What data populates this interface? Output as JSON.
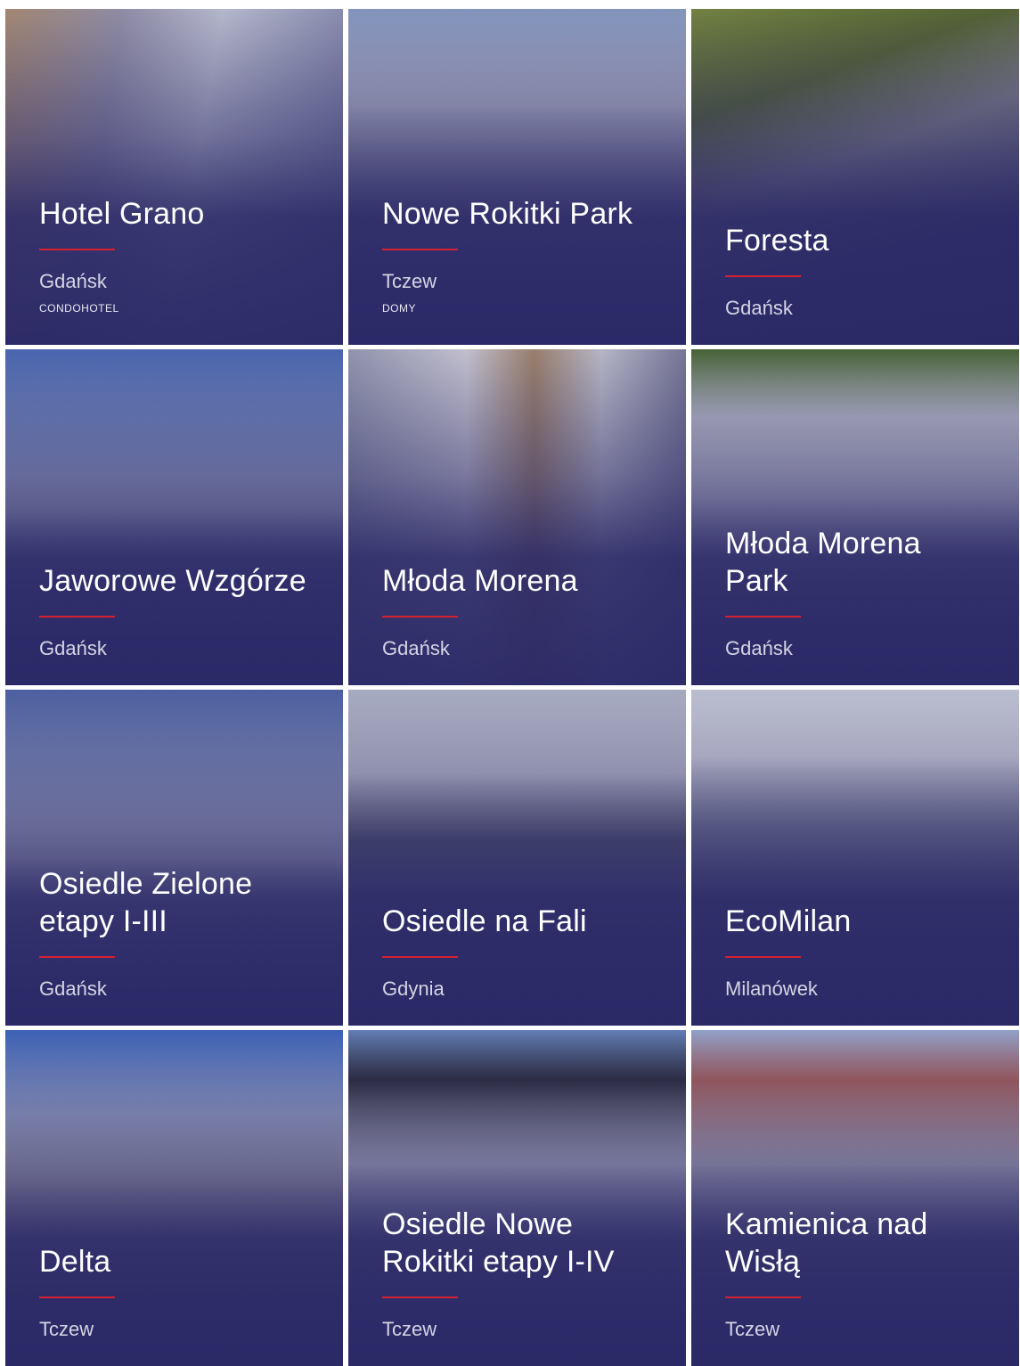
{
  "projects": [
    {
      "title": "Hotel Grano",
      "city": "Gdańsk",
      "category": "CONDOHOTEL"
    },
    {
      "title": "Nowe Rokitki Park",
      "city": "Tczew",
      "category": "DOMY"
    },
    {
      "title": "Foresta",
      "city": "Gdańsk",
      "category": ""
    },
    {
      "title": "Jaworowe Wzgórze",
      "city": "Gdańsk",
      "category": ""
    },
    {
      "title": "Młoda Morena",
      "city": "Gdańsk",
      "category": ""
    },
    {
      "title": "Młoda Morena Park",
      "city": "Gdańsk",
      "category": ""
    },
    {
      "title": "Osiedle Zielone etapy I-III",
      "city": "Gdańsk",
      "category": ""
    },
    {
      "title": "Osiedle na Fali",
      "city": "Gdynia",
      "category": ""
    },
    {
      "title": "EcoMilan",
      "city": "Milanówek",
      "category": ""
    },
    {
      "title": "Delta",
      "city": "Tczew",
      "category": ""
    },
    {
      "title": "Osiedle Nowe Rokitki etapy I-IV",
      "city": "Tczew",
      "category": ""
    },
    {
      "title": "Kamienica nad Wisłą",
      "city": "Tczew",
      "category": ""
    }
  ],
  "colors": {
    "overlay": "#2a2866",
    "accent_rule": "#d42030",
    "title": "#ffffff",
    "city": "#d4d4e4"
  }
}
